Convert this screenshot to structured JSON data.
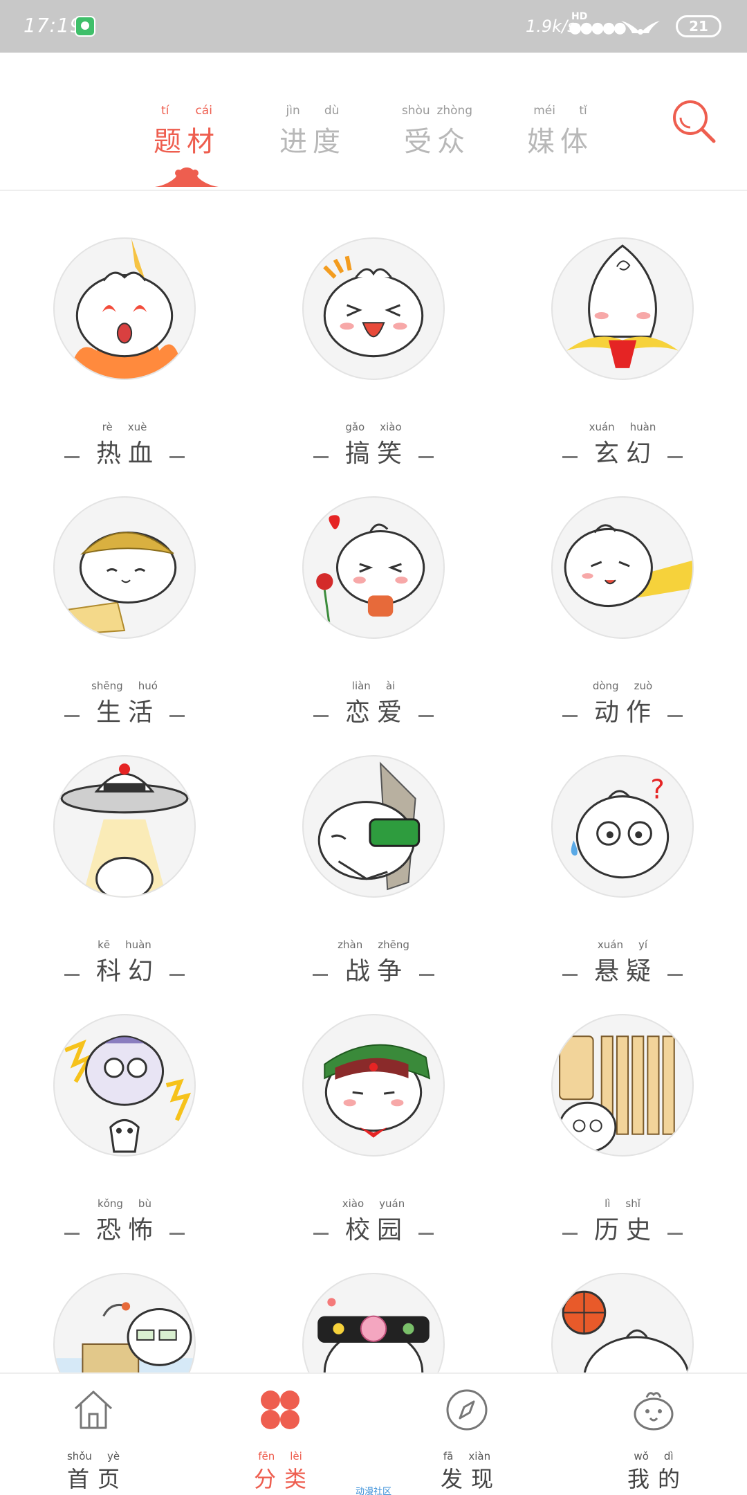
{
  "status_bar": {
    "time": "17:19",
    "network_speed": "1.9k/s",
    "signal_label": "HD",
    "battery": "21",
    "dots": "●●●●●"
  },
  "top_tabs": [
    {
      "pinyin": [
        "tí",
        "cái"
      ],
      "label": "题材",
      "active": true
    },
    {
      "pinyin": [
        "jìn",
        "dù"
      ],
      "label": "进度",
      "active": false
    },
    {
      "pinyin": [
        "shòu",
        "zhòng"
      ],
      "label": "受众",
      "active": false
    },
    {
      "pinyin": [
        "méi",
        "tǐ"
      ],
      "label": "媒体",
      "active": false
    }
  ],
  "categories": [
    {
      "pinyin": [
        "rè",
        "xuè"
      ],
      "label": "热血",
      "icon": "hot-blood-avatar"
    },
    {
      "pinyin": [
        "gǎo",
        "xiào"
      ],
      "label": "搞笑",
      "icon": "funny-avatar"
    },
    {
      "pinyin": [
        "xuán",
        "huàn"
      ],
      "label": "玄幻",
      "icon": "fantasy-avatar"
    },
    {
      "pinyin": [
        "shēng",
        "huó"
      ],
      "label": "生活",
      "icon": "life-avatar"
    },
    {
      "pinyin": [
        "liàn",
        "ài"
      ],
      "label": "恋爱",
      "icon": "romance-avatar"
    },
    {
      "pinyin": [
        "dòng",
        "zuò"
      ],
      "label": "动作",
      "icon": "action-avatar"
    },
    {
      "pinyin": [
        "kē",
        "huàn"
      ],
      "label": "科幻",
      "icon": "scifi-avatar"
    },
    {
      "pinyin": [
        "zhàn",
        "zhēng"
      ],
      "label": "战争",
      "icon": "war-avatar"
    },
    {
      "pinyin": [
        "xuán",
        "yí"
      ],
      "label": "悬疑",
      "icon": "mystery-avatar"
    },
    {
      "pinyin": [
        "kǒng",
        "bù"
      ],
      "label": "恐怖",
      "icon": "horror-avatar"
    },
    {
      "pinyin": [
        "xiào",
        "yuán"
      ],
      "label": "校园",
      "icon": "campus-avatar"
    },
    {
      "pinyin": [
        "lì",
        "shǐ"
      ],
      "label": "历史",
      "icon": "history-avatar"
    },
    {
      "pinyin": [
        "",
        ""
      ],
      "label": "",
      "icon": "city-avatar"
    },
    {
      "pinyin": [
        "",
        ""
      ],
      "label": "",
      "icon": "ancient-avatar"
    },
    {
      "pinyin": [
        "",
        ""
      ],
      "label": "",
      "icon": "sports-avatar"
    }
  ],
  "bottom_nav": [
    {
      "pinyin": [
        "shǒu",
        "yè"
      ],
      "label": "首页",
      "icon": "home-icon",
      "active": false
    },
    {
      "pinyin": [
        "fēn",
        "lèi"
      ],
      "label": "分类",
      "icon": "category-icon",
      "active": true
    },
    {
      "pinyin": [
        "fā",
        "xiàn"
      ],
      "label": "发现",
      "icon": "compass-icon",
      "active": false
    },
    {
      "pinyin": [
        "wǒ",
        "dì"
      ],
      "label": "我的",
      "icon": "profile-icon",
      "active": false
    }
  ],
  "community_label": "动漫社区",
  "colors": {
    "accent": "#ee5e4f",
    "status_bar": "#c8c8c8",
    "inactive_tab": "#b8b8b8"
  }
}
